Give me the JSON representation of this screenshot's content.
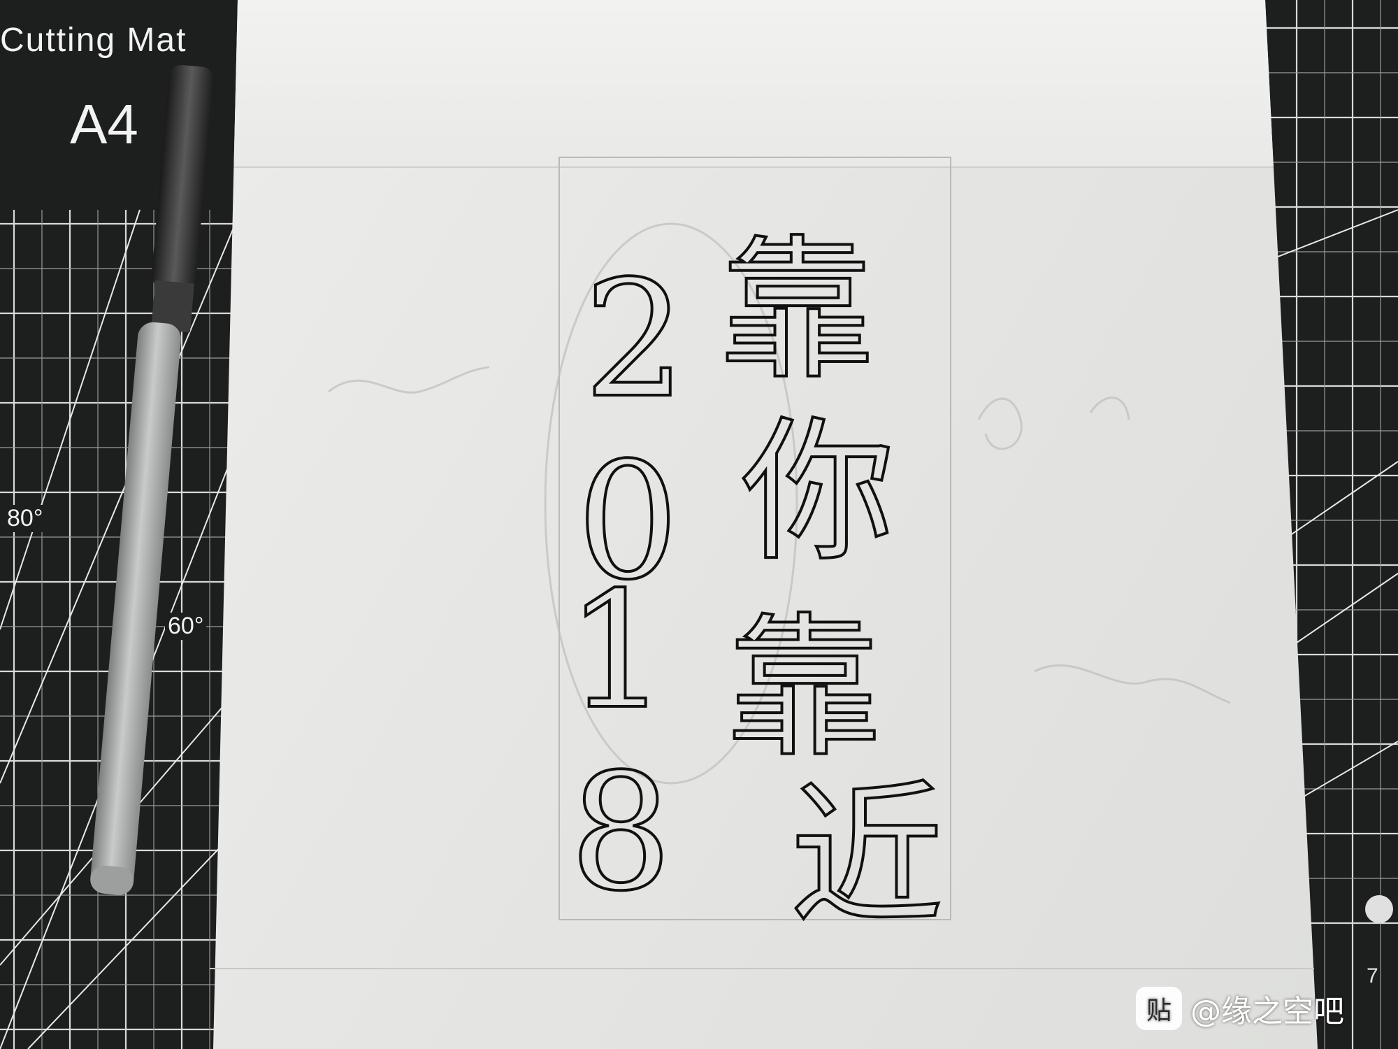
{
  "photo": {
    "mat_brand": "Cutting Mat",
    "mat_size": "A4",
    "mat_angle_marks": [
      "80°",
      "60°"
    ],
    "mat_right_digit": "7",
    "drawing_chars_right": [
      "靠",
      "你",
      "靠",
      "近"
    ],
    "drawing_digits_left": [
      "2",
      "0",
      "1",
      "8"
    ],
    "watermark": {
      "logo_char": "贴",
      "text": "@缘之空吧"
    }
  },
  "colors": {
    "mat": "#1d1e1e",
    "grid_line": "#d9d9d9",
    "paper": "#e6e6e4",
    "ink": "#111111",
    "pen_body": "#b8b9b9",
    "pen_cap": "#2a2a2a"
  }
}
